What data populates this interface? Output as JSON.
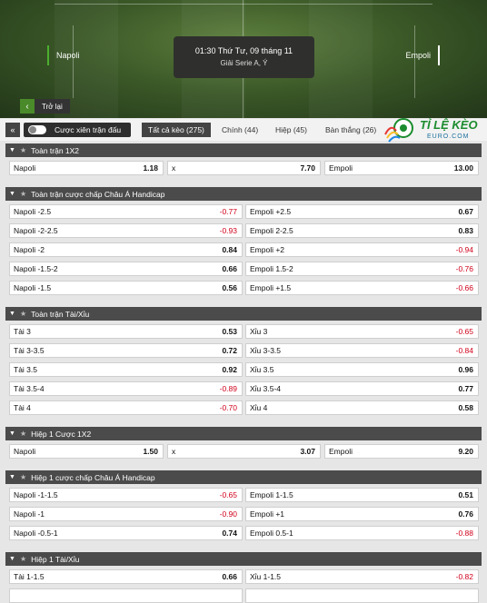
{
  "match": {
    "home": "Napoli",
    "away": "Empoli",
    "time": "01:30 Thứ Tư, 09 tháng 11",
    "league": "Giải Serie A, Ý",
    "back_label": "Trở lại"
  },
  "filters": {
    "toggle_label": "Cược xiên trận đấu",
    "tabs": [
      "Tất cả kèo (275)",
      "Chính (44)",
      "Hiệp (45)",
      "Bàn thắng (26)"
    ]
  },
  "logo": {
    "title": "TỈ LỆ KÈO",
    "subtitle": "EURO.COM"
  },
  "sections": [
    {
      "title": "Toàn trận 1X2",
      "cols": 3,
      "rows": [
        [
          {
            "label": "Napoli",
            "value": "1.18"
          },
          {
            "label": "x",
            "value": "7.70"
          },
          {
            "label": "Empoli",
            "value": "13.00"
          }
        ]
      ]
    },
    {
      "title": "Toàn trận cược chấp Châu Á Handicap",
      "cols": 2,
      "rows": [
        [
          {
            "label": "Napoli -2.5",
            "value": "-0.77"
          },
          {
            "label": "Empoli +2.5",
            "value": "0.67"
          }
        ],
        [
          {
            "label": "Napoli -2-2.5",
            "value": "-0.93"
          },
          {
            "label": "Empoli 2-2.5",
            "value": "0.83"
          }
        ],
        [
          {
            "label": "Napoli -2",
            "value": "0.84"
          },
          {
            "label": "Empoli +2",
            "value": "-0.94"
          }
        ],
        [
          {
            "label": "Napoli -1.5-2",
            "value": "0.66"
          },
          {
            "label": "Empoli 1.5-2",
            "value": "-0.76"
          }
        ],
        [
          {
            "label": "Napoli -1.5",
            "value": "0.56"
          },
          {
            "label": "Empoli +1.5",
            "value": "-0.66"
          }
        ]
      ]
    },
    {
      "title": "Toàn trận Tài/Xỉu",
      "cols": 2,
      "rows": [
        [
          {
            "label": "Tài 3",
            "value": "0.53"
          },
          {
            "label": "Xỉu 3",
            "value": "-0.65"
          }
        ],
        [
          {
            "label": "Tài 3-3.5",
            "value": "0.72"
          },
          {
            "label": "Xỉu 3-3.5",
            "value": "-0.84"
          }
        ],
        [
          {
            "label": "Tài 3.5",
            "value": "0.92"
          },
          {
            "label": "Xỉu 3.5",
            "value": "0.96"
          }
        ],
        [
          {
            "label": "Tài 3.5-4",
            "value": "-0.89"
          },
          {
            "label": "Xỉu 3.5-4",
            "value": "0.77"
          }
        ],
        [
          {
            "label": "Tài 4",
            "value": "-0.70"
          },
          {
            "label": "Xỉu 4",
            "value": "0.58"
          }
        ]
      ]
    },
    {
      "title": "Hiệp 1 Cược 1X2",
      "cols": 3,
      "rows": [
        [
          {
            "label": "Napoli",
            "value": "1.50"
          },
          {
            "label": "x",
            "value": "3.07"
          },
          {
            "label": "Empoli",
            "value": "9.20"
          }
        ]
      ]
    },
    {
      "title": "Hiệp 1 cược chấp Châu Á Handicap",
      "cols": 2,
      "rows": [
        [
          {
            "label": "Napoli -1-1.5",
            "value": "-0.65"
          },
          {
            "label": "Empoli 1-1.5",
            "value": "0.51"
          }
        ],
        [
          {
            "label": "Napoli -1",
            "value": "-0.90"
          },
          {
            "label": "Empoli +1",
            "value": "0.76"
          }
        ],
        [
          {
            "label": "Napoli -0.5-1",
            "value": "0.74"
          },
          {
            "label": "Empoli 0.5-1",
            "value": "-0.88"
          }
        ]
      ]
    },
    {
      "title": "Hiệp 1 Tài/Xỉu",
      "cols": 2,
      "rows": [
        [
          {
            "label": "Tài 1-1.5",
            "value": "0.66"
          },
          {
            "label": "Xỉu 1-1.5",
            "value": "-0.82"
          }
        ],
        [
          {
            "label": "",
            "value": ""
          },
          {
            "label": "",
            "value": ""
          }
        ]
      ]
    }
  ]
}
